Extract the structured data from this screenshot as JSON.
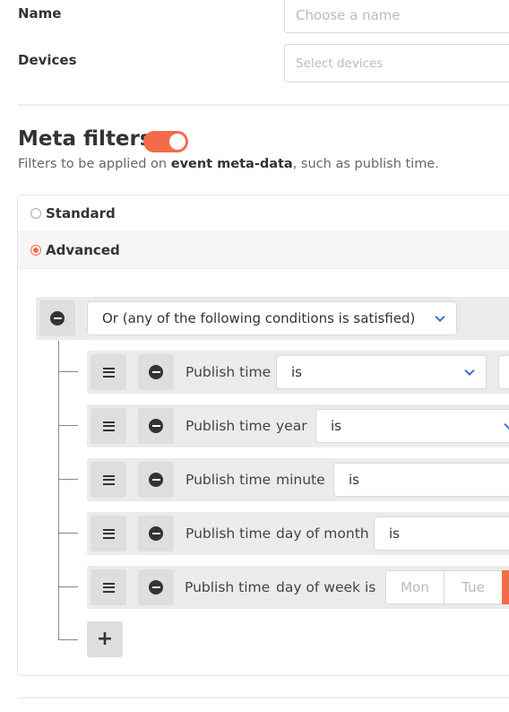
{
  "form": {
    "name_label": "Name",
    "name_placeholder": "Choose a name",
    "devices_label": "Devices",
    "devices_placeholder": "Select devices"
  },
  "meta": {
    "title": "Meta filters",
    "toggle_on": true,
    "desc_prefix": "Filters to be applied on ",
    "desc_bold": "event meta-data",
    "desc_suffix": ", such as publish time."
  },
  "mode": {
    "standard_label": "Standard",
    "advanced_label": "Advanced",
    "selected": "Advanced"
  },
  "group": {
    "combinator": "Or (any of the following conditions is satisfied)"
  },
  "rules": [
    {
      "field": "Publish time",
      "part": "",
      "operator": "is"
    },
    {
      "field": "Publish time",
      "part": "year",
      "operator": "is"
    },
    {
      "field": "Publish time",
      "part": "minute",
      "operator": "is"
    },
    {
      "field": "Publish time",
      "part": "day of month",
      "operator": "is"
    },
    {
      "field": "Publish time",
      "part": "day of week",
      "operator": "is",
      "days": [
        "Mon",
        "Tue"
      ]
    }
  ],
  "colors": {
    "accent": "#f56b4a",
    "chevron": "#3b6fd4"
  }
}
